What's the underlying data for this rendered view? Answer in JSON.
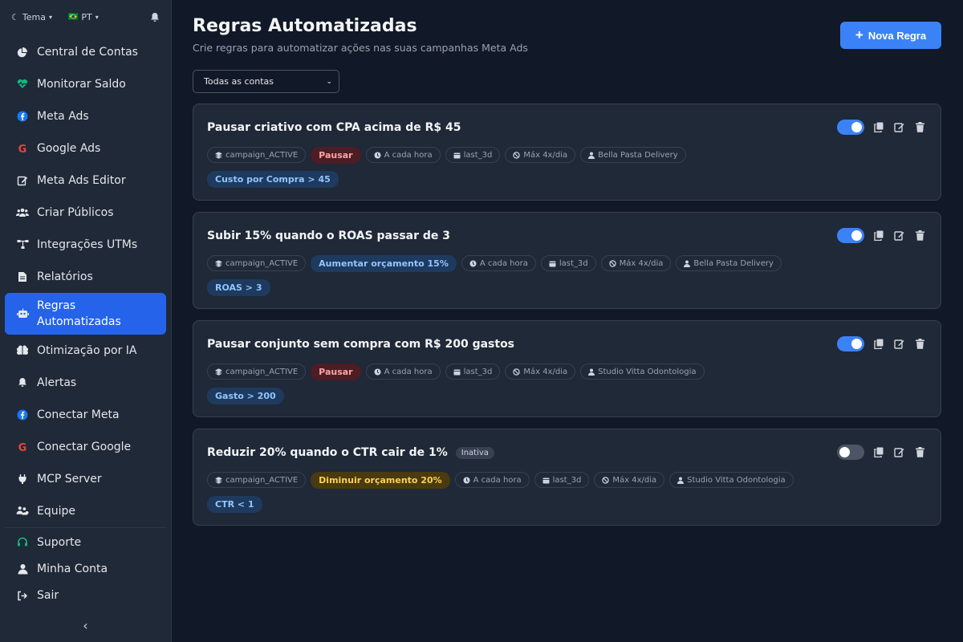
{
  "topbar": {
    "theme_label": "Tema",
    "lang_label": "PT",
    "lang_flag": "🇧🇷"
  },
  "sidebar": {
    "items": [
      {
        "label": "Central de Contas",
        "icon": "pie-chart-icon"
      },
      {
        "label": "Monitorar Saldo",
        "icon": "heart-pulse-icon"
      },
      {
        "label": "Meta Ads",
        "icon": "facebook-icon"
      },
      {
        "label": "Google Ads",
        "icon": "google-icon"
      },
      {
        "label": "Meta Ads Editor",
        "icon": "edit-icon"
      },
      {
        "label": "Criar Públicos",
        "icon": "users-icon"
      },
      {
        "label": "Integrações UTMs",
        "icon": "network-icon"
      },
      {
        "label": "Relatórios",
        "icon": "file-icon"
      },
      {
        "label": "Regras Automatizadas",
        "icon": "robot-icon"
      },
      {
        "label": "Otimização por IA",
        "icon": "brain-icon"
      },
      {
        "label": "Alertas",
        "icon": "bell-icon"
      },
      {
        "label": "Conectar Meta",
        "icon": "facebook-icon"
      },
      {
        "label": "Conectar Google",
        "icon": "google-icon"
      },
      {
        "label": "MCP Server",
        "icon": "plug-icon"
      },
      {
        "label": "Equipe",
        "icon": "team-icon"
      }
    ],
    "bottom": [
      {
        "label": "Suporte",
        "icon": "headset-icon"
      },
      {
        "label": "Minha Conta",
        "icon": "user-icon"
      },
      {
        "label": "Sair",
        "icon": "logout-icon"
      }
    ]
  },
  "header": {
    "title": "Regras Automatizadas",
    "subtitle": "Crie regras para automatizar ações nas suas campanhas Meta Ads",
    "new_rule_label": "Nova Regra"
  },
  "filter": {
    "selected": "Todas as contas"
  },
  "rules": [
    {
      "title": "Pausar criativo com CPA acima de R$ 45",
      "inactive_label": "",
      "enabled": true,
      "scope": "campaign_ACTIVE",
      "action": "Pausar",
      "action_color": "red",
      "frequency": "A cada hora",
      "window": "last_3d",
      "limit": "Máx 4x/dia",
      "account": "Bella Pasta Delivery",
      "condition": "Custo por Compra > 45"
    },
    {
      "title": "Subir 15% quando o ROAS passar de 3",
      "inactive_label": "",
      "enabled": true,
      "scope": "campaign_ACTIVE",
      "action": "Aumentar orçamento 15%",
      "action_color": "blue",
      "frequency": "A cada hora",
      "window": "last_3d",
      "limit": "Máx 4x/dia",
      "account": "Bella Pasta Delivery",
      "condition": "ROAS > 3"
    },
    {
      "title": "Pausar conjunto sem compra com R$ 200 gastos",
      "inactive_label": "",
      "enabled": true,
      "scope": "campaign_ACTIVE",
      "action": "Pausar",
      "action_color": "red",
      "frequency": "A cada hora",
      "window": "last_3d",
      "limit": "Máx 4x/dia",
      "account": "Studio Vitta Odontologia",
      "condition": "Gasto > 200"
    },
    {
      "title": "Reduzir 20% quando o CTR cair de 1%",
      "inactive_label": "Inativa",
      "enabled": false,
      "scope": "campaign_ACTIVE",
      "action": "Diminuir orçamento 20%",
      "action_color": "yellow",
      "frequency": "A cada hora",
      "window": "last_3d",
      "limit": "Máx 4x/dia",
      "account": "Studio Vitta Odontologia",
      "condition": "CTR < 1"
    }
  ],
  "colors": {
    "accent": "#3b82f6",
    "active_nav": "#2563eb",
    "bg": "#111827",
    "panel": "#1f2937"
  }
}
